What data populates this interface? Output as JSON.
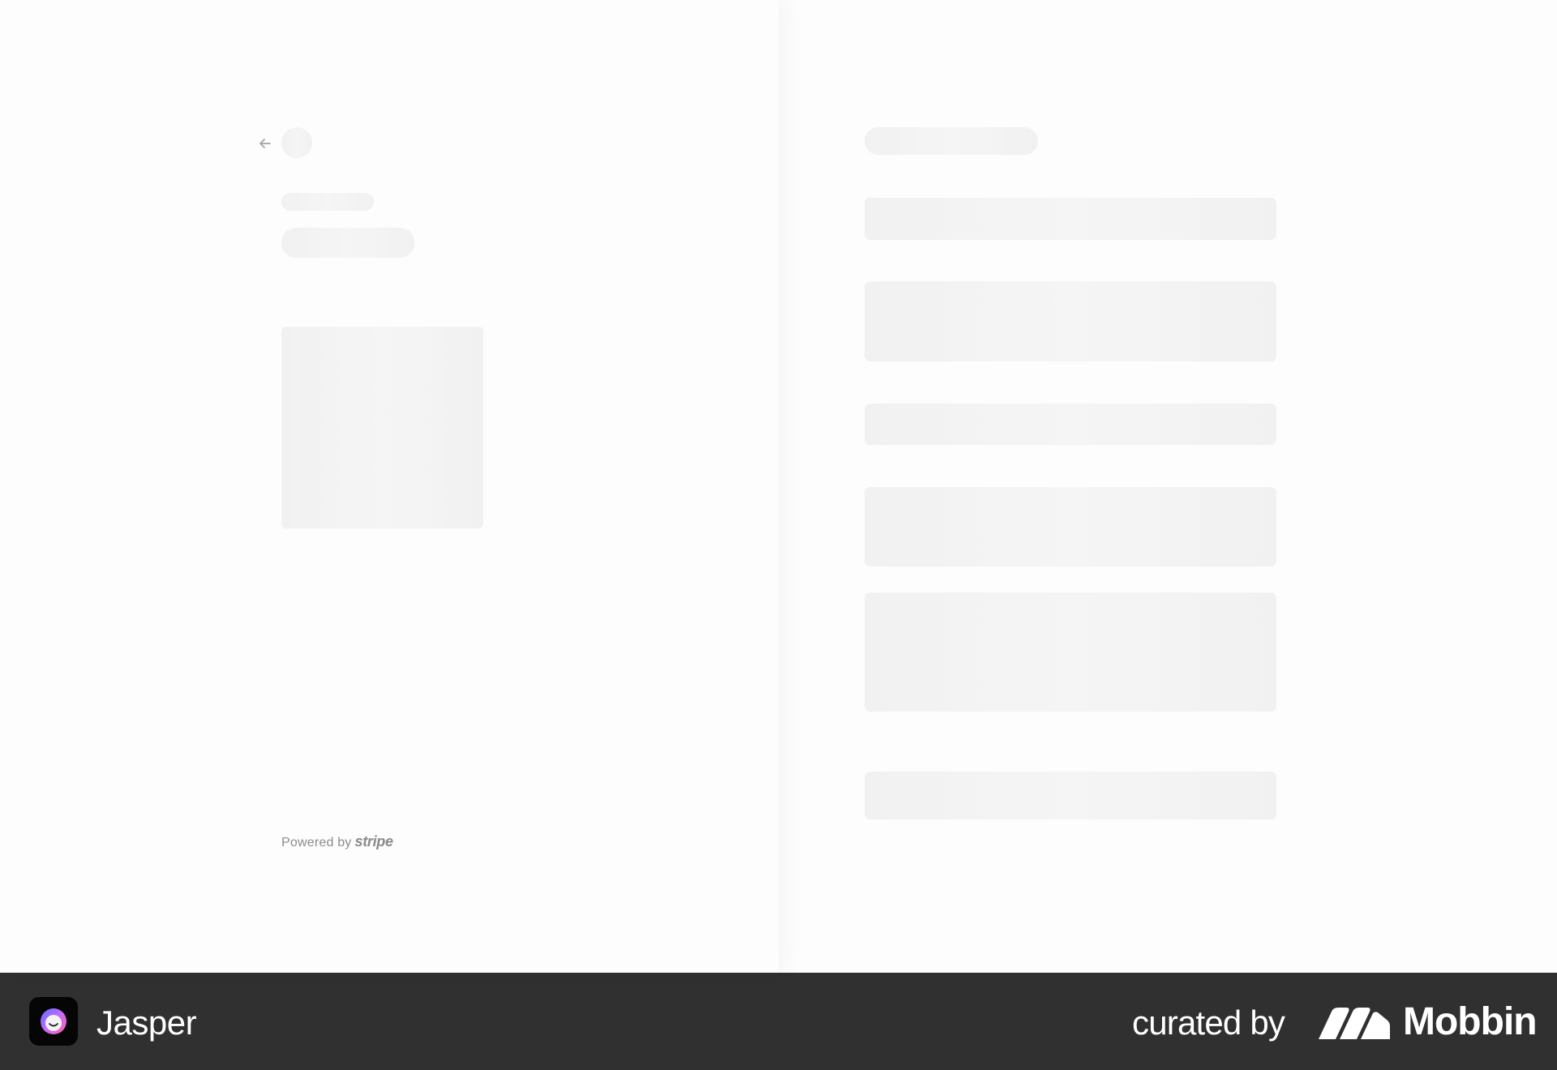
{
  "checkout": {
    "powered_by_label": "Powered by",
    "stripe_wordmark": "stripe",
    "back_icon": "arrow-left-icon",
    "loading_state": "skeleton"
  },
  "footer": {
    "app_name": "Jasper",
    "app_icon": "jasper-logo-icon",
    "curated_label": "curated by",
    "brand_name": "Mobbin",
    "brand_icon": "mobbin-logo-icon"
  },
  "colors": {
    "background": "#fdfdfd",
    "skeleton": "#f2f2f2",
    "footer_background": "#303030",
    "footer_text": "#ffffff",
    "muted_text": "#8c8c8c"
  }
}
